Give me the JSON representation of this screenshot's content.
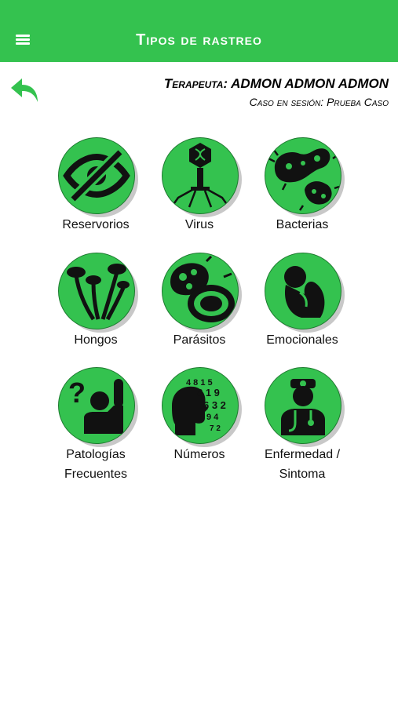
{
  "appbar": {
    "title": "Tipos de rastreo"
  },
  "header": {
    "therapist_label": "Terapeuta:",
    "therapist_name": "ADMON ADMON ADMON",
    "case_label": "Caso en sesión:",
    "case_name": "Prueba Caso"
  },
  "colors": {
    "accent": "#34c24f",
    "icon": "#111111"
  },
  "tiles": [
    {
      "label": "Reservorios",
      "icon": "hidden-eye-icon"
    },
    {
      "label": "Virus",
      "icon": "virus-icon"
    },
    {
      "label": "Bacterias",
      "icon": "bacteria-icon"
    },
    {
      "label": "Hongos",
      "icon": "mushroom-icon"
    },
    {
      "label": "Parásitos",
      "icon": "parasite-cell-icon"
    },
    {
      "label": "Emocionales",
      "icon": "sad-person-icon"
    },
    {
      "label": "Patologías\nFrecuentes",
      "label_line1": "Patologías",
      "label_line2": "Frecuentes",
      "icon": "question-person-icon"
    },
    {
      "label": "Números",
      "icon": "numbers-head-icon"
    },
    {
      "label": "Enfermedad /\nSintoma",
      "label_line1": "Enfermedad /",
      "label_line2": "Sintoma",
      "icon": "doctor-icon"
    }
  ]
}
